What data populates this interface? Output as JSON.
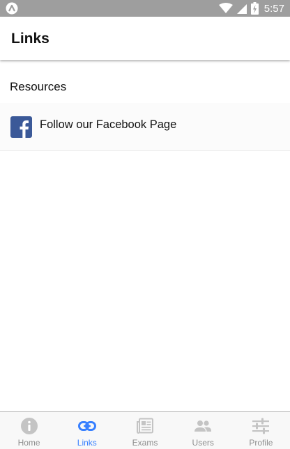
{
  "status_bar": {
    "time": "5:57",
    "battery_glyph": "⚡",
    "icons": [
      "app-logo-icon",
      "wifi-icon",
      "cell-signal-icon",
      "battery-charging-icon"
    ]
  },
  "header": {
    "title": "Links"
  },
  "main": {
    "section_title": "Resources",
    "links": [
      {
        "label": "Follow our Facebook Page",
        "icon": "facebook-icon"
      }
    ]
  },
  "bottom_nav": {
    "active_color": "#3880ff",
    "inactive_color": "#8e8e8e",
    "tabs": [
      {
        "label": "Home",
        "icon": "info-icon",
        "active": false
      },
      {
        "label": "Links",
        "icon": "link-icon",
        "active": true
      },
      {
        "label": "Exams",
        "icon": "newspaper-icon",
        "active": false
      },
      {
        "label": "Users",
        "icon": "people-icon",
        "active": false
      },
      {
        "label": "Profile",
        "icon": "options-icon",
        "active": false
      }
    ]
  },
  "colors": {
    "status_bar_bg": "#9e9e9e",
    "facebook_blue": "#3b5998",
    "accent": "#3880ff"
  }
}
